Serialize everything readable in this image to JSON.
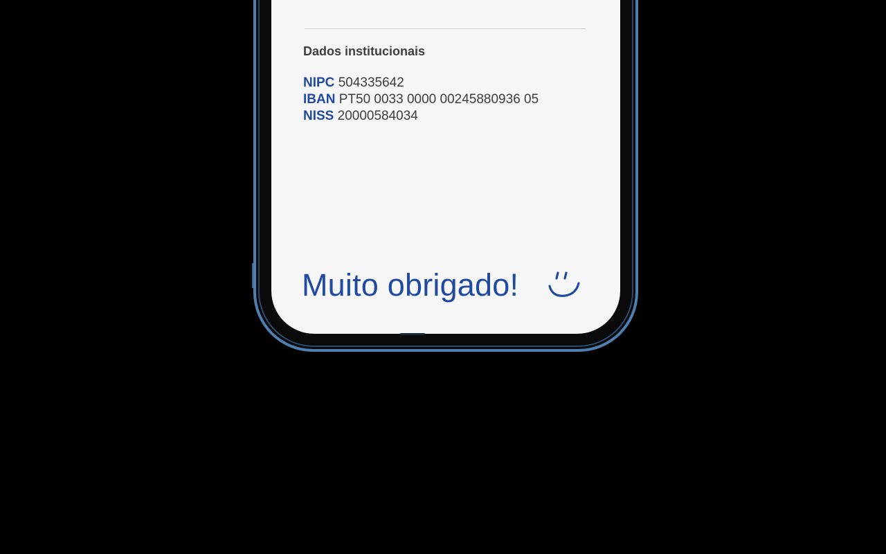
{
  "section": {
    "title": "Dados institucionais"
  },
  "info": [
    {
      "label": "NIPC",
      "value": "504335642"
    },
    {
      "label": "IBAN",
      "value": "PT50 0033 0000 00245880936 05"
    },
    {
      "label": "NISS",
      "value": "20000584034"
    }
  ],
  "footer": {
    "message": "Muito obrigado!",
    "icon": "smile-icon"
  },
  "colors": {
    "background": "#000000",
    "screen": "#f6f6f6",
    "accent_blue": "#1f4aa0",
    "frame_blue": "#4f7fb0",
    "text": "#3d3d3d"
  }
}
